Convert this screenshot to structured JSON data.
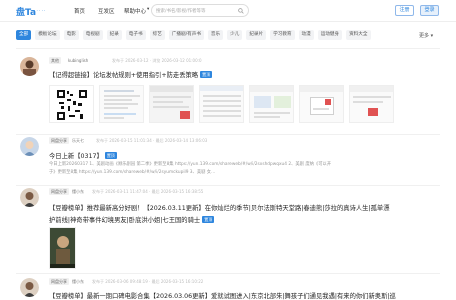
{
  "header": {
    "logo": "盘Ta",
    "logo_sub": "· · · · ·",
    "nav": [
      "首页",
      "互发区",
      "帮助中心"
    ],
    "nav_arrow": "▾",
    "search_placeholder": "搜索/书名/影视/作者等等",
    "login": "注册",
    "register": "登录"
  },
  "categories": [
    "全部",
    "模板论坛",
    "电影",
    "电视剧",
    "纪录",
    "电子书",
    "综艺",
    "广播剧/有声书",
    "音乐",
    "少儿",
    "纪录片",
    "学习教育",
    "动漫",
    "运动健身",
    "资料大全"
  ],
  "active_category": "全部",
  "more": "更多 ▾",
  "posts": [
    {
      "tag": "其他",
      "user": "kubinglish",
      "meta": "发布于 2026-03-12 · 浏览 2026-03-12 01:00:0",
      "title": "【记得超链接】论坛发帖规则+使用指引+防走丢策略",
      "badge": "置顶"
    },
    {
      "tag": "网盘分享",
      "user": "乐天七",
      "meta": "发布于 2026-03-15 11:01:34 · 最后 2026-03-14 13:06:03",
      "title": "今日上新【0317】",
      "badge": "置顶",
      "snippet1": "今日上新20260317 1、美剧动画《顾乐剧园 第二季》更新至8集 https://yun.139.com/shareweb/#/w/i/2sxshdpwqxu4 2、美剧 度纳《可以开",
      "snippet2": "于》更新至8集 https://yun.139.com/shareweb/#/w/i/2syumckupil9 3、美剧 女..."
    },
    {
      "tag": "网盘分享",
      "user": "懂小东",
      "meta": "发布于 2026-03-11 11:47:04 · 最后 2026-03-15 16:38:55",
      "title1": "【豆瓣榜单】推荐最新高分好剧！【2026.03.11更新】在你灿烂的季节|贝尔法斯特天堂路|春迪熊|莎拉的真诗人生|孤单漂",
      "title2": "护前线|神奇带事件幻境男友|卧底洪小姐|七王国的骑士",
      "badge": "置顶"
    },
    {
      "tag": "网盘分享",
      "user": "懂小东",
      "meta": "发布于 2026-03-06 09:48:19 · 最后 2026-03-15 16:10:22",
      "title": "【豆瓣榜单】最新一期口碑电影合集【2026.03.06更新】爱就试图进入|东京北部朱|舞孩子们通见我遇|有来的你们新奥斯|巡"
    }
  ]
}
